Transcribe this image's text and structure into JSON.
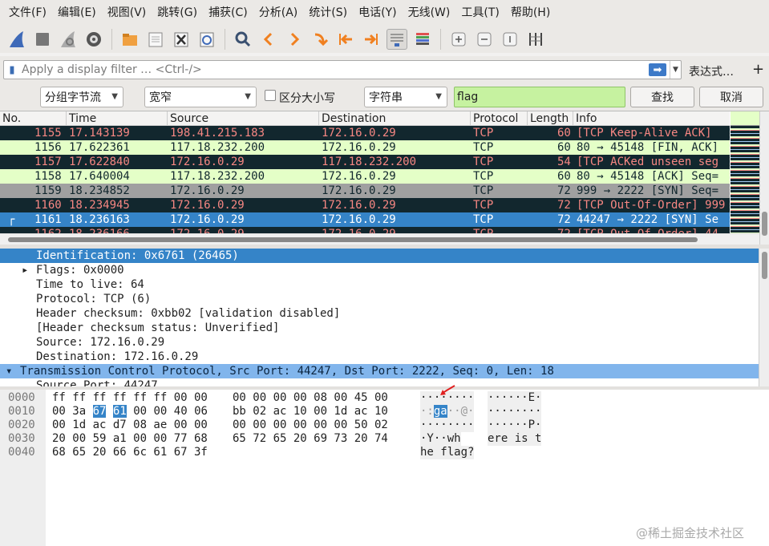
{
  "menu": [
    "文件(F)",
    "编辑(E)",
    "视图(V)",
    "跳转(G)",
    "捕获(C)",
    "分析(A)",
    "统计(S)",
    "电话(Y)",
    "无线(W)",
    "工具(T)",
    "帮助(H)"
  ],
  "toolbar": {
    "icons": [
      "shark-fin-start-icon",
      "stop-capture-icon",
      "restart-capture-icon",
      "capture-options-icon",
      "open-file-icon",
      "save-file-icon",
      "close-file-icon",
      "reload-file-icon",
      "find-packet-icon",
      "go-back-icon",
      "go-forward-icon",
      "go-to-packet-icon",
      "go-first-icon",
      "go-last-icon",
      "autoscroll-icon",
      "colorize-icon",
      "zoom-in-icon",
      "zoom-out-icon",
      "normal-size-icon",
      "resize-columns-icon"
    ]
  },
  "filter": {
    "placeholder": "Apply a display filter … <Ctrl-/>",
    "expression_label": "表达式…",
    "plus": "+"
  },
  "find": {
    "search_in": "分组字节流",
    "char_width": "宽窄",
    "case_label": "区分大小写",
    "type": "字符串",
    "query": "flag",
    "find_button": "查找",
    "cancel_button": "取消"
  },
  "packet_list": {
    "columns": [
      "No.",
      "Time",
      "Source",
      "Destination",
      "Protocol",
      "Length",
      "Info"
    ],
    "rows": [
      {
        "no": "1155",
        "time": "17.143139",
        "src": "198.41.215.183",
        "dst": "172.16.0.29",
        "proto": "TCP",
        "len": "60",
        "info": "[TCP Keep-Alive ACK]",
        "style": "dark"
      },
      {
        "no": "1156",
        "time": "17.622361",
        "src": "117.18.232.200",
        "dst": "172.16.0.29",
        "proto": "TCP",
        "len": "60",
        "info": "80 → 45148 [FIN, ACK]",
        "style": "green"
      },
      {
        "no": "1157",
        "time": "17.622840",
        "src": "172.16.0.29",
        "dst": "117.18.232.200",
        "proto": "TCP",
        "len": "54",
        "info": "[TCP ACKed unseen seg",
        "style": "dark"
      },
      {
        "no": "1158",
        "time": "17.640004",
        "src": "117.18.232.200",
        "dst": "172.16.0.29",
        "proto": "TCP",
        "len": "60",
        "info": "80 → 45148 [ACK] Seq=",
        "style": "green"
      },
      {
        "no": "1159",
        "time": "18.234852",
        "src": "172.16.0.29",
        "dst": "172.16.0.29",
        "proto": "TCP",
        "len": "72",
        "info": "999 → 2222 [SYN] Seq=",
        "style": "gray"
      },
      {
        "no": "1160",
        "time": "18.234945",
        "src": "172.16.0.29",
        "dst": "172.16.0.29",
        "proto": "TCP",
        "len": "72",
        "info": "[TCP Out-Of-Order] 999",
        "style": "dark"
      },
      {
        "no": "1161",
        "time": "18.236163",
        "src": "172.16.0.29",
        "dst": "172.16.0.29",
        "proto": "TCP",
        "len": "72",
        "info": "44247 → 2222 [SYN] Se",
        "style": "selected"
      },
      {
        "no": "1162",
        "time": "18.236166",
        "src": "172.16.0.29",
        "dst": "172.16.0.29",
        "proto": "TCP",
        "len": "72",
        "info": "[TCP Out-Of-Order] 44",
        "style": "dark"
      }
    ]
  },
  "details": [
    {
      "text": "Identification: 0x6761 (26465)",
      "indent": 45,
      "style": "hl",
      "expander": ""
    },
    {
      "text": "Flags: 0x0000",
      "indent": 45,
      "style": "",
      "expander": "▸"
    },
    {
      "text": "Time to live: 64",
      "indent": 45,
      "style": "",
      "expander": ""
    },
    {
      "text": "Protocol: TCP (6)",
      "indent": 45,
      "style": "",
      "expander": ""
    },
    {
      "text": "Header checksum: 0xbb02 [validation disabled]",
      "indent": 45,
      "style": "",
      "expander": ""
    },
    {
      "text": "[Header checksum status: Unverified]",
      "indent": 45,
      "style": "",
      "expander": ""
    },
    {
      "text": "Source: 172.16.0.29",
      "indent": 45,
      "style": "",
      "expander": ""
    },
    {
      "text": "Destination: 172.16.0.29",
      "indent": 45,
      "style": "",
      "expander": ""
    },
    {
      "text": "Transmission Control Protocol, Src Port: 44247, Dst Port: 2222, Seq: 0, Len: 18",
      "indent": 25,
      "style": "hl2",
      "expander": "▾"
    },
    {
      "text": "Source Port: 44247",
      "indent": 45,
      "style": "",
      "expander": ""
    }
  ],
  "bytes": [
    {
      "offset": "0000",
      "hex1": "ff ff ff ff ff ff 00 00",
      "hex2": "00 00 00 00 08 00 45 00",
      "ascii1": "········",
      "ascii2": "······E·"
    },
    {
      "offset": "0010",
      "hex1": "00 3a 67 61 00 00 40 06",
      "hex2": "bb 02 ac 10 00 1d ac 10",
      "ascii1": "·:ga··@·",
      "ascii2": "········"
    },
    {
      "offset": "0020",
      "hex1": "00 1d ac d7 08 ae 00 00",
      "hex2": "00 00 00 00 00 00 50 02",
      "ascii1": "········",
      "ascii2": "······P·"
    },
    {
      "offset": "0030",
      "hex1": "20 00 59 a1 00 00 77 68",
      "hex2": "65 72 65 20 69 73 20 74",
      "ascii1": " ·Y··wh",
      "ascii2": "ere is t"
    },
    {
      "offset": "0040",
      "hex1": "68 65 20 66 6c 61 67 3f",
      "hex2": "",
      "ascii1": "he flag?",
      "ascii2": ""
    }
  ],
  "selection": {
    "hex_row0010_a": "67",
    "hex_row0010_b": "61",
    "ascii": "ga"
  },
  "watermark": "@稀土掘金技术社区"
}
